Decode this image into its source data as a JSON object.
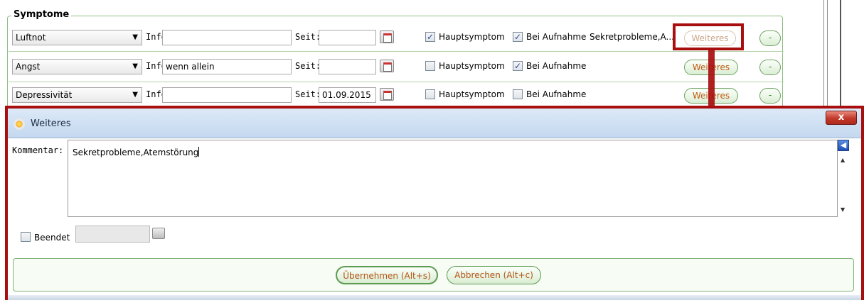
{
  "symptoms": {
    "legend": "Symptome",
    "rows": [
      {
        "name": "Luftnot",
        "info_label": "Info:",
        "info_value": "",
        "seit_label": "Seit:",
        "seit_value": "",
        "hauptsymptom_label": "Hauptsymptom",
        "hauptsymptom_checked": "✓",
        "aufnahme_label": "Bei Aufnahme",
        "aufnahme_checked": "✓",
        "extra_text": "Sekretprobleme,A...",
        "weiteres_label": "Weiteres",
        "remove_label": "-"
      },
      {
        "name": "Angst",
        "info_label": "Info:",
        "info_value": "wenn allein",
        "seit_label": "Seit:",
        "seit_value": "",
        "hauptsymptom_label": "Hauptsymptom",
        "hauptsymptom_checked": "",
        "aufnahme_label": "Bei Aufnahme",
        "aufnahme_checked": "✓",
        "extra_text": "",
        "weiteres_label": "Weiteres",
        "remove_label": "-"
      },
      {
        "name": "Depressivität",
        "info_label": "Info:",
        "info_value": "",
        "seit_label": "Seit:",
        "seit_value": "01.09.2015",
        "hauptsymptom_label": "Hauptsymptom",
        "hauptsymptom_checked": "",
        "aufnahme_label": "Bei Aufnahme",
        "aufnahme_checked": "",
        "extra_text": "",
        "weiteres_label": "Weiteres",
        "remove_label": "-"
      }
    ]
  },
  "dialog": {
    "title": "Weiteres",
    "close_label": "x",
    "kommentar_label": "Kommentar:",
    "kommentar_value": "Sekretprobleme,Atemstörung",
    "beendet_label": "Beendet",
    "ok_label": "Übernehmen (Alt+s)",
    "cancel_label": "Abbrechen (Alt+c)"
  },
  "colors": {
    "highlight": "#a80e0e",
    "button_text": "#c25b16",
    "panel_border": "#8dbd84"
  }
}
